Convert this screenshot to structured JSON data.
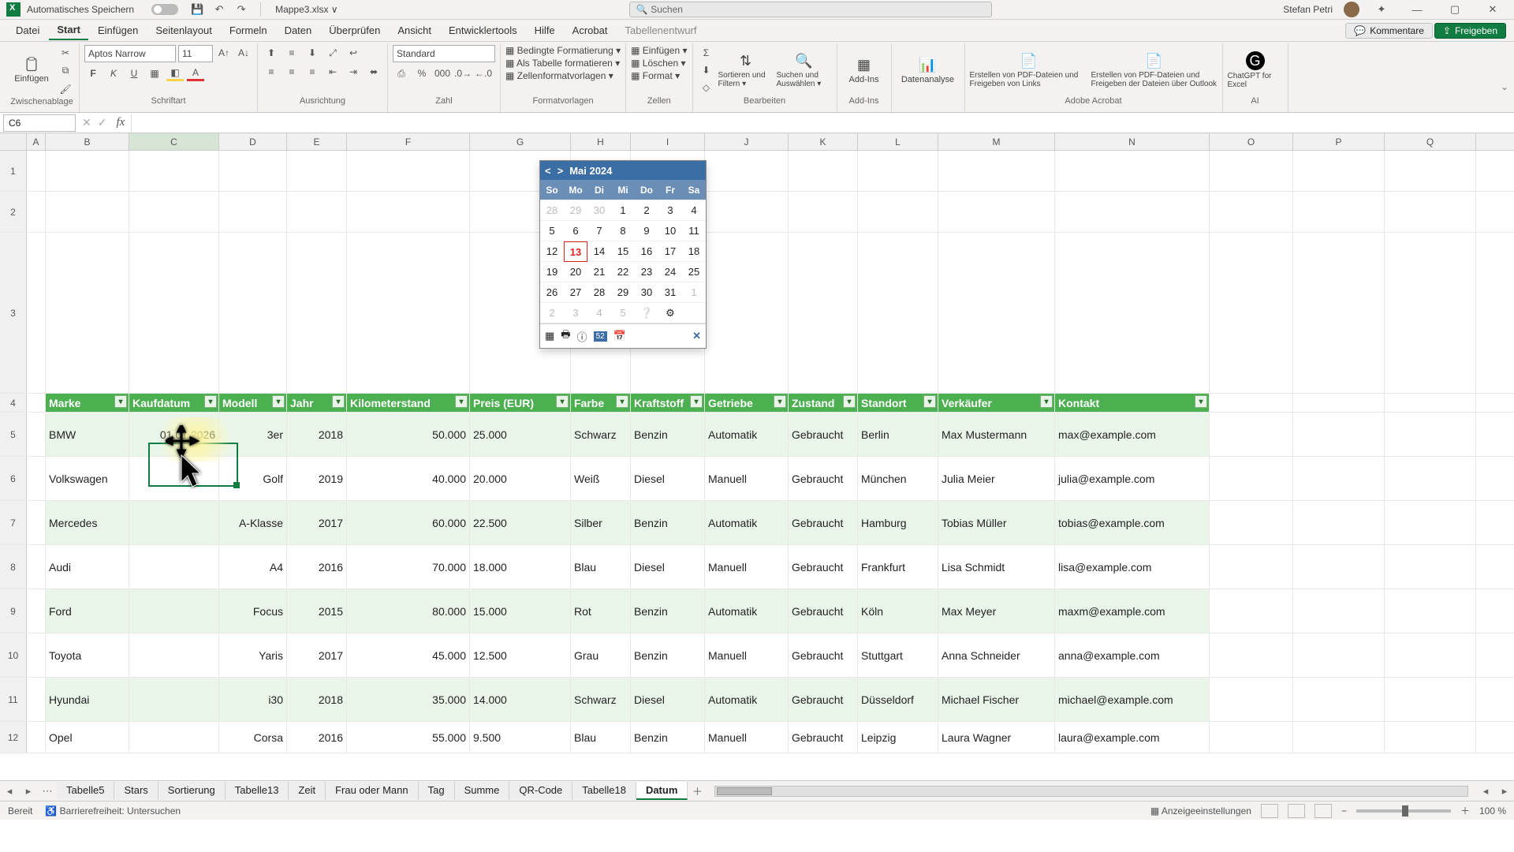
{
  "titlebar": {
    "autosave_label": "Automatisches Speichern",
    "filename": "Mappe3.xlsx ∨",
    "search_placeholder": "Suchen",
    "user": "Stefan Petri"
  },
  "tabs": {
    "items": [
      "Datei",
      "Start",
      "Einfügen",
      "Seitenlayout",
      "Formeln",
      "Daten",
      "Überprüfen",
      "Ansicht",
      "Entwicklertools",
      "Hilfe",
      "Acrobat",
      "Tabellenentwurf"
    ],
    "comments": "Kommentare",
    "share": "Freigeben"
  },
  "ribbon": {
    "paste": "Einfügen",
    "clipboard": "Zwischenablage",
    "font_name": "Aptos Narrow",
    "font_size": "11",
    "font": "Schriftart",
    "alignment": "Ausrichtung",
    "number_format": "Standard",
    "number": "Zahl",
    "cond_format": "Bedingte Formatierung ▾",
    "as_table": "Als Tabelle formatieren ▾",
    "cell_styles": "Zellenformatvorlagen ▾",
    "styles": "Formatvorlagen",
    "insert": "Einfügen ▾",
    "delete": "Löschen ▾",
    "format": "Format ▾",
    "cells": "Zellen",
    "sort_filter": "Sortieren und Filtern ▾",
    "find_select": "Suchen und Auswählen ▾",
    "editing": "Bearbeiten",
    "addins": "Add-Ins",
    "addins_lbl": "Add-Ins",
    "data_analysis": "Datenanalyse",
    "pdf1": "Erstellen von PDF-Dateien und Freigeben von Links",
    "pdf2": "Erstellen von PDF-Dateien und Freigeben der Dateien über Outlook",
    "acrobat": "Adobe Acrobat",
    "gpt": "ChatGPT for Excel",
    "ai": "AI"
  },
  "namebox": "C6",
  "columns": [
    "A",
    "B",
    "C",
    "D",
    "E",
    "F",
    "G",
    "H",
    "I",
    "J",
    "K",
    "L",
    "M",
    "N",
    "O",
    "P",
    "Q"
  ],
  "rownums": [
    "1",
    "2",
    "3",
    "4",
    "5",
    "6",
    "7",
    "8",
    "9",
    "10",
    "11",
    "12"
  ],
  "headers": [
    "Marke",
    "Kaufdatum",
    "Modell",
    "Jahr",
    "Kilometerstand",
    "Preis (EUR)",
    "Farbe",
    "Kraftstoff",
    "Getriebe",
    "Zustand",
    "Standort",
    "Verkäufer",
    "Kontakt"
  ],
  "table": [
    {
      "marke": "BMW",
      "kauf": "01.01.2026",
      "modell": "3er",
      "jahr": "2018",
      "km": "50.000",
      "preis": "25.000",
      "farbe": "Schwarz",
      "kraft": "Benzin",
      "getriebe": "Automatik",
      "zustand": "Gebraucht",
      "standort": "Berlin",
      "verk": "Max Mustermann",
      "kontakt": "max@example.com"
    },
    {
      "marke": "Volkswagen",
      "kauf": "",
      "modell": "Golf",
      "jahr": "2019",
      "km": "40.000",
      "preis": "20.000",
      "farbe": "Weiß",
      "kraft": "Diesel",
      "getriebe": "Manuell",
      "zustand": "Gebraucht",
      "standort": "München",
      "verk": "Julia Meier",
      "kontakt": "julia@example.com"
    },
    {
      "marke": "Mercedes",
      "kauf": "",
      "modell": "A-Klasse",
      "jahr": "2017",
      "km": "60.000",
      "preis": "22.500",
      "farbe": "Silber",
      "kraft": "Benzin",
      "getriebe": "Automatik",
      "zustand": "Gebraucht",
      "standort": "Hamburg",
      "verk": "Tobias Müller",
      "kontakt": "tobias@example.com"
    },
    {
      "marke": "Audi",
      "kauf": "",
      "modell": "A4",
      "jahr": "2016",
      "km": "70.000",
      "preis": "18.000",
      "farbe": "Blau",
      "kraft": "Diesel",
      "getriebe": "Manuell",
      "zustand": "Gebraucht",
      "standort": "Frankfurt",
      "verk": "Lisa Schmidt",
      "kontakt": "lisa@example.com"
    },
    {
      "marke": "Ford",
      "kauf": "",
      "modell": "Focus",
      "jahr": "2015",
      "km": "80.000",
      "preis": "15.000",
      "farbe": "Rot",
      "kraft": "Benzin",
      "getriebe": "Automatik",
      "zustand": "Gebraucht",
      "standort": "Köln",
      "verk": "Max Meyer",
      "kontakt": "maxm@example.com"
    },
    {
      "marke": "Toyota",
      "kauf": "",
      "modell": "Yaris",
      "jahr": "2017",
      "km": "45.000",
      "preis": "12.500",
      "farbe": "Grau",
      "kraft": "Benzin",
      "getriebe": "Manuell",
      "zustand": "Gebraucht",
      "standort": "Stuttgart",
      "verk": "Anna Schneider",
      "kontakt": "anna@example.com"
    },
    {
      "marke": "Hyundai",
      "kauf": "",
      "modell": "i30",
      "jahr": "2018",
      "km": "35.000",
      "preis": "14.000",
      "farbe": "Schwarz",
      "kraft": "Diesel",
      "getriebe": "Automatik",
      "zustand": "Gebraucht",
      "standort": "Düsseldorf",
      "verk": "Michael Fischer",
      "kontakt": "michael@example.com"
    },
    {
      "marke": "Opel",
      "kauf": "",
      "modell": "Corsa",
      "jahr": "2016",
      "km": "55.000",
      "preis": "9.500",
      "farbe": "Blau",
      "kraft": "Benzin",
      "getriebe": "Manuell",
      "zustand": "Gebraucht",
      "standort": "Leipzig",
      "verk": "Laura Wagner",
      "kontakt": "laura@example.com"
    }
  ],
  "datepicker": {
    "title": "Mai 2024",
    "dow": [
      "So",
      "Mo",
      "Di",
      "Mi",
      "Do",
      "Fr",
      "Sa"
    ],
    "days": [
      {
        "d": "28",
        "o": true
      },
      {
        "d": "29",
        "o": true
      },
      {
        "d": "30",
        "o": true
      },
      {
        "d": "1"
      },
      {
        "d": "2"
      },
      {
        "d": "3"
      },
      {
        "d": "4"
      },
      {
        "d": "5"
      },
      {
        "d": "6"
      },
      {
        "d": "7"
      },
      {
        "d": "8"
      },
      {
        "d": "9"
      },
      {
        "d": "10"
      },
      {
        "d": "11"
      },
      {
        "d": "12"
      },
      {
        "d": "13",
        "t": true
      },
      {
        "d": "14"
      },
      {
        "d": "15"
      },
      {
        "d": "16"
      },
      {
        "d": "17"
      },
      {
        "d": "18"
      },
      {
        "d": "19"
      },
      {
        "d": "20"
      },
      {
        "d": "21"
      },
      {
        "d": "22"
      },
      {
        "d": "23"
      },
      {
        "d": "24"
      },
      {
        "d": "25"
      },
      {
        "d": "26"
      },
      {
        "d": "27"
      },
      {
        "d": "28"
      },
      {
        "d": "29"
      },
      {
        "d": "30"
      },
      {
        "d": "31"
      },
      {
        "d": "1",
        "o": true
      },
      {
        "d": "2",
        "o": true
      },
      {
        "d": "3",
        "o": true
      },
      {
        "d": "4",
        "o": true
      },
      {
        "d": "5",
        "o": true
      },
      {
        "d": "❔"
      },
      {
        "d": "⚙"
      },
      {
        "d": ""
      }
    ]
  },
  "sheets": [
    "Tabelle5",
    "Stars",
    "Sortierung",
    "Tabelle13",
    "Zeit",
    "Frau oder Mann",
    "Tag",
    "Summe",
    "QR-Code",
    "Tabelle18",
    "Datum"
  ],
  "active_sheet": "Datum",
  "status": {
    "ready": "Bereit",
    "access": "Barrierefreiheit: Untersuchen",
    "display": "Anzeigeeinstellungen",
    "zoom": "100 %"
  }
}
